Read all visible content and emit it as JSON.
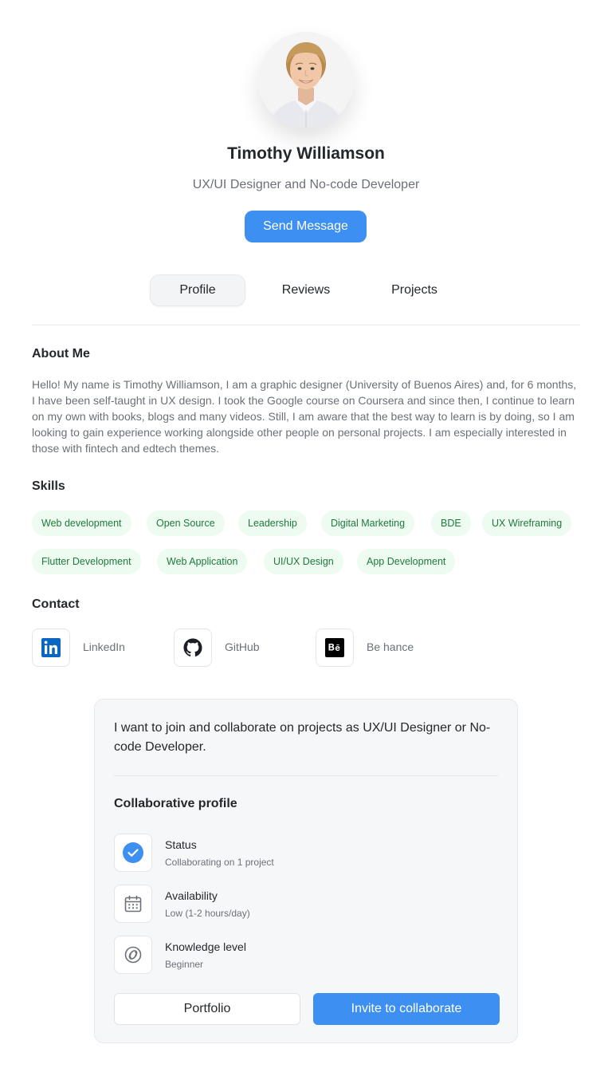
{
  "profile": {
    "name": "Timothy Williamson",
    "title": "UX/UI Designer and No-code Developer",
    "send_message_label": "Send Message"
  },
  "tabs": [
    {
      "label": "Profile",
      "active": true
    },
    {
      "label": "Reviews",
      "active": false
    },
    {
      "label": "Projects",
      "active": false
    }
  ],
  "about": {
    "heading": "About Me",
    "text": "Hello! My name is Timothy Williamson, I am a graphic designer (University of Buenos Aires) and, for 6 months, I have been self-taught in UX design. I took the Google course on Coursera and since then, I continue to learn on my own with books, blogs and many videos. Still, I am aware that the best way to learn is by doing, so I am looking to gain experience working alongside other people on personal projects. I am especially interested in those with fintech and edtech themes."
  },
  "skills": {
    "heading": "Skills",
    "items": [
      "Web development",
      "Open Source",
      "Leadership",
      "Digital Marketing",
      "BDE",
      "UX Wireframing",
      "Flutter Development",
      "Web Application",
      "UI/UX Design",
      "App Development"
    ]
  },
  "contact": {
    "heading": "Contact",
    "items": [
      {
        "label": "LinkedIn",
        "icon": "linkedin-icon"
      },
      {
        "label": "GitHub",
        "icon": "github-icon"
      },
      {
        "label": "Be hance",
        "icon": "behance-icon"
      }
    ]
  },
  "collab": {
    "intro": "I want to join and collaborate on projects  as UX/UI Designer or No-code Developer.",
    "heading": "Collaborative profile",
    "items": [
      {
        "label": "Status",
        "value": "Collaborating on 1 project",
        "icon": "check-circle-icon"
      },
      {
        "label": "Availability",
        "value": "Low (1-2 hours/day)",
        "icon": "calendar-icon"
      },
      {
        "label": "Knowledge level",
        "value": "Beginner",
        "icon": "knowledge-icon"
      }
    ],
    "portfolio_label": "Portfolio",
    "invite_label": "Invite to collaborate"
  },
  "colors": {
    "accent": "#3d8ff2",
    "chip_bg": "#eefbf1",
    "chip_text": "#1e7a3a"
  }
}
